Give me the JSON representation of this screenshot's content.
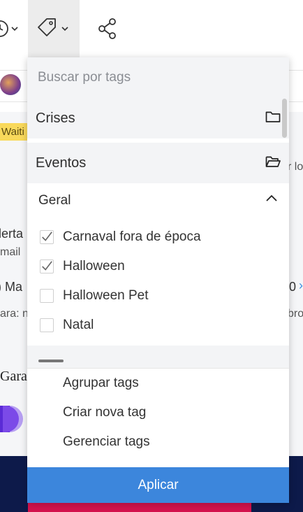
{
  "toolbar": {
    "icons": [
      "clock-icon",
      "tag-icon",
      "share-icon"
    ]
  },
  "background": {
    "badge": "Waiti",
    "right_snippet_1": "r lo",
    "left_text_1": "lerta",
    "left_text_2": "mail",
    "left_text_3": ") Ma",
    "left_text_4": "ara: n",
    "right_text_3": "0",
    "right_link_3": "›",
    "right_text_4": "bro",
    "left_text_5": "Gara"
  },
  "dropdown": {
    "search_placeholder": "Buscar por tags",
    "folders": [
      {
        "label": "Crises",
        "icon": "folder-closed-icon"
      },
      {
        "label": "Eventos",
        "icon": "folder-open-icon"
      }
    ],
    "group": {
      "label": "Geral",
      "expanded": true,
      "items": [
        {
          "label": "Carnaval fora de época",
          "checked": true
        },
        {
          "label": "Halloween",
          "checked": true
        },
        {
          "label": "Halloween Pet",
          "checked": false
        },
        {
          "label": "Natal",
          "checked": false
        }
      ]
    },
    "actions": [
      "Agrupar tags",
      "Criar nova tag",
      "Gerenciar tags"
    ],
    "apply_label": "Aplicar"
  },
  "colors": {
    "accent": "#3c86dc",
    "badge_bg": "#f9d95b",
    "panel_gray": "#f3f4f6"
  }
}
